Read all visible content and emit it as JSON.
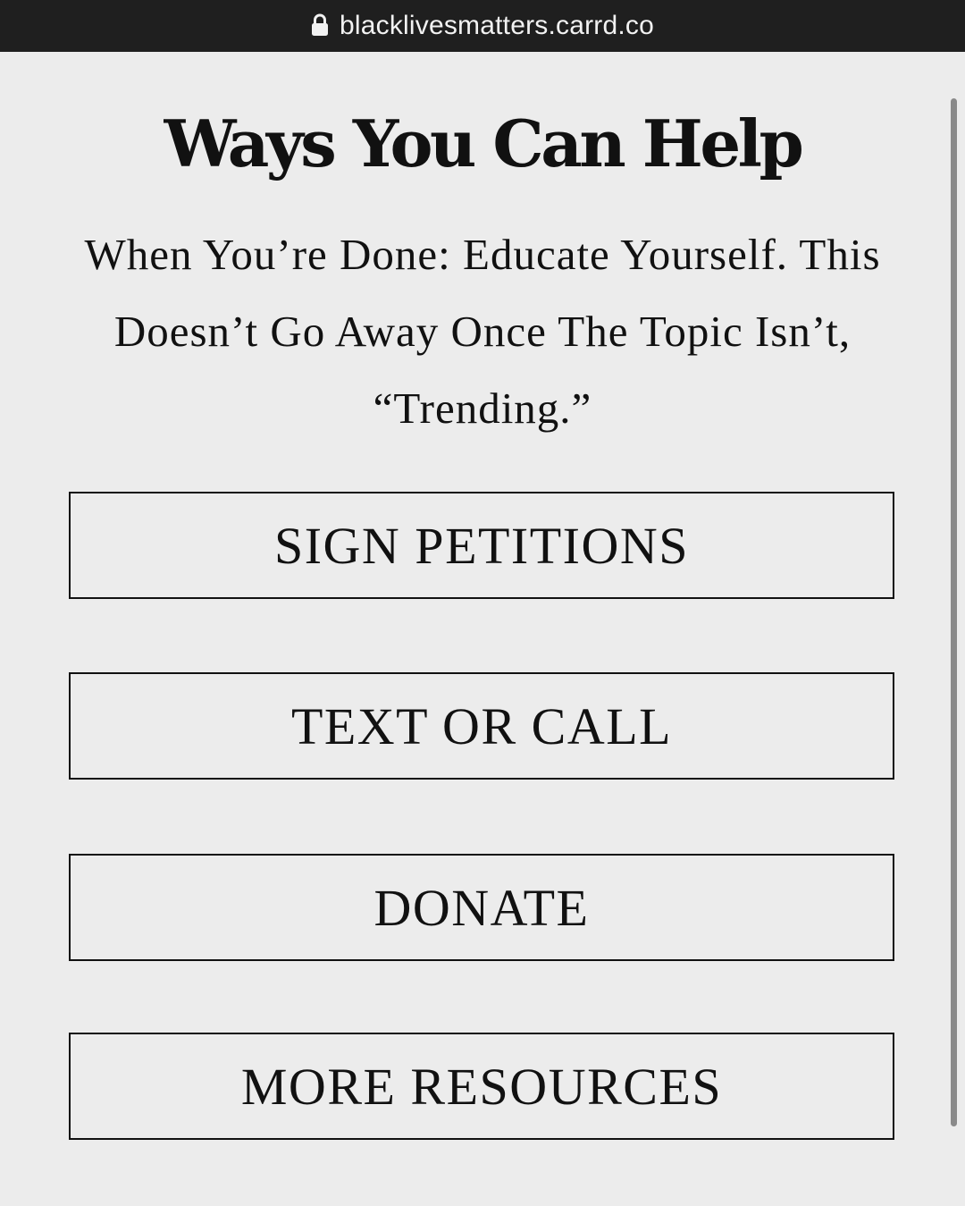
{
  "browser": {
    "url": "blacklivesmatters.carrd.co",
    "lock_icon": "lock-icon"
  },
  "main": {
    "title": "Ways You Can Help",
    "subtitle": "When You’re Done: Educate Yourself. This Doesn’t Go Away Once The Topic Isn’t, “Trending.”",
    "buttons": [
      {
        "label": "SIGN PETITIONS"
      },
      {
        "label": "TEXT OR CALL"
      },
      {
        "label": "DONATE"
      },
      {
        "label": "MORE RESOURCES"
      }
    ]
  },
  "colors": {
    "url_bar": "#1f1f1f",
    "page_background": "#ececec",
    "text": "#111111"
  }
}
